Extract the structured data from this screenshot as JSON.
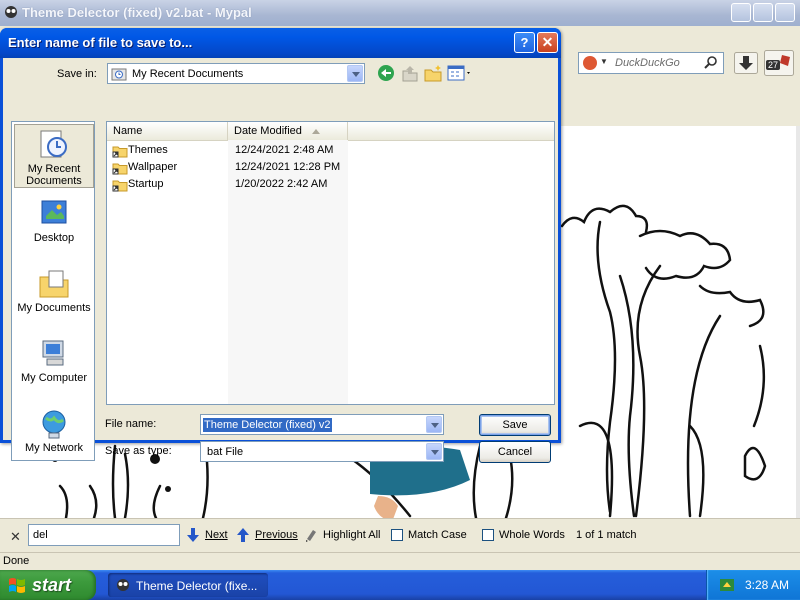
{
  "browser": {
    "title": "Theme Delector (fixed) v2.bat - Mypal",
    "search_placeholder": "DuckDuckGo",
    "badge_count": "27"
  },
  "dialog": {
    "title": "Enter name of file to save to...",
    "help_label": "?",
    "close_label": "✕",
    "save_in_label": "Save in:",
    "save_in_value": "My Recent Documents",
    "places": [
      {
        "label": "My Recent Documents",
        "icon": "recent-documents-icon",
        "selected": true
      },
      {
        "label": "Desktop",
        "icon": "desktop-icon"
      },
      {
        "label": "My Documents",
        "icon": "my-documents-icon"
      },
      {
        "label": "My Computer",
        "icon": "my-computer-icon"
      },
      {
        "label": "My Network",
        "icon": "my-network-icon"
      }
    ],
    "columns": {
      "name": "Name",
      "date": "Date Modified"
    },
    "files": [
      {
        "name": "Themes",
        "date": "12/24/2021 2:48 AM"
      },
      {
        "name": "Wallpaper",
        "date": "12/24/2021 12:28 PM"
      },
      {
        "name": "Startup",
        "date": "1/20/2022 2:42 AM"
      }
    ],
    "file_name_label": "File name:",
    "file_name_value": "Theme Delector (fixed) v2",
    "save_type_label": "Save as type:",
    "save_type_value": "bat File",
    "save_button": "Save",
    "cancel_button": "Cancel"
  },
  "findbar": {
    "close": "✕",
    "query": "del",
    "next": "Next",
    "previous": "Previous",
    "highlight_all": "Highlight All",
    "match_case": "Match Case",
    "whole_words": "Whole Words",
    "result": "1 of 1 match"
  },
  "status": "Done",
  "taskbar": {
    "start": "start",
    "task_label": "Theme Delector (fixe...",
    "clock": "3:28 AM"
  },
  "colors": {
    "xp_blue": "#0a50d8",
    "dialog_face": "#ece9d8",
    "selection": "#316ac5",
    "figure_teal": "#1f6f8b"
  }
}
